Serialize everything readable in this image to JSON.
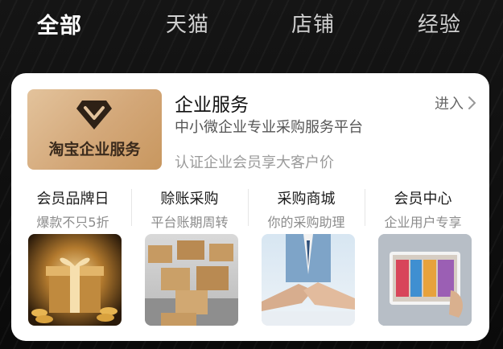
{
  "tabs": [
    {
      "label": "全部",
      "active": true
    },
    {
      "label": "天猫",
      "active": false
    },
    {
      "label": "店铺",
      "active": false
    },
    {
      "label": "经验",
      "active": false
    }
  ],
  "service": {
    "logo_text": "淘宝企业服务",
    "title": "企业服务",
    "subtitle": "中小微企业专业采购服务平台",
    "note": "认证企业会员享大客户价",
    "enter_label": "进入",
    "enter_icon": "chevron-right-icon"
  },
  "features": [
    {
      "title": "会员品牌日",
      "subtitle": "爆款不只5折",
      "image": "gift-box-image"
    },
    {
      "title": "赊账采购",
      "subtitle": "平台账期周转",
      "image": "warehouse-boxes-image"
    },
    {
      "title": "采购商城",
      "subtitle": "你的采购助理",
      "image": "handshake-image"
    },
    {
      "title": "会员中心",
      "subtitle": "企业用户专享",
      "image": "store-tablet-image"
    }
  ],
  "colors": {
    "background": "#0d0d0d",
    "card": "#ffffff",
    "logo_gold": "#d3a778"
  }
}
